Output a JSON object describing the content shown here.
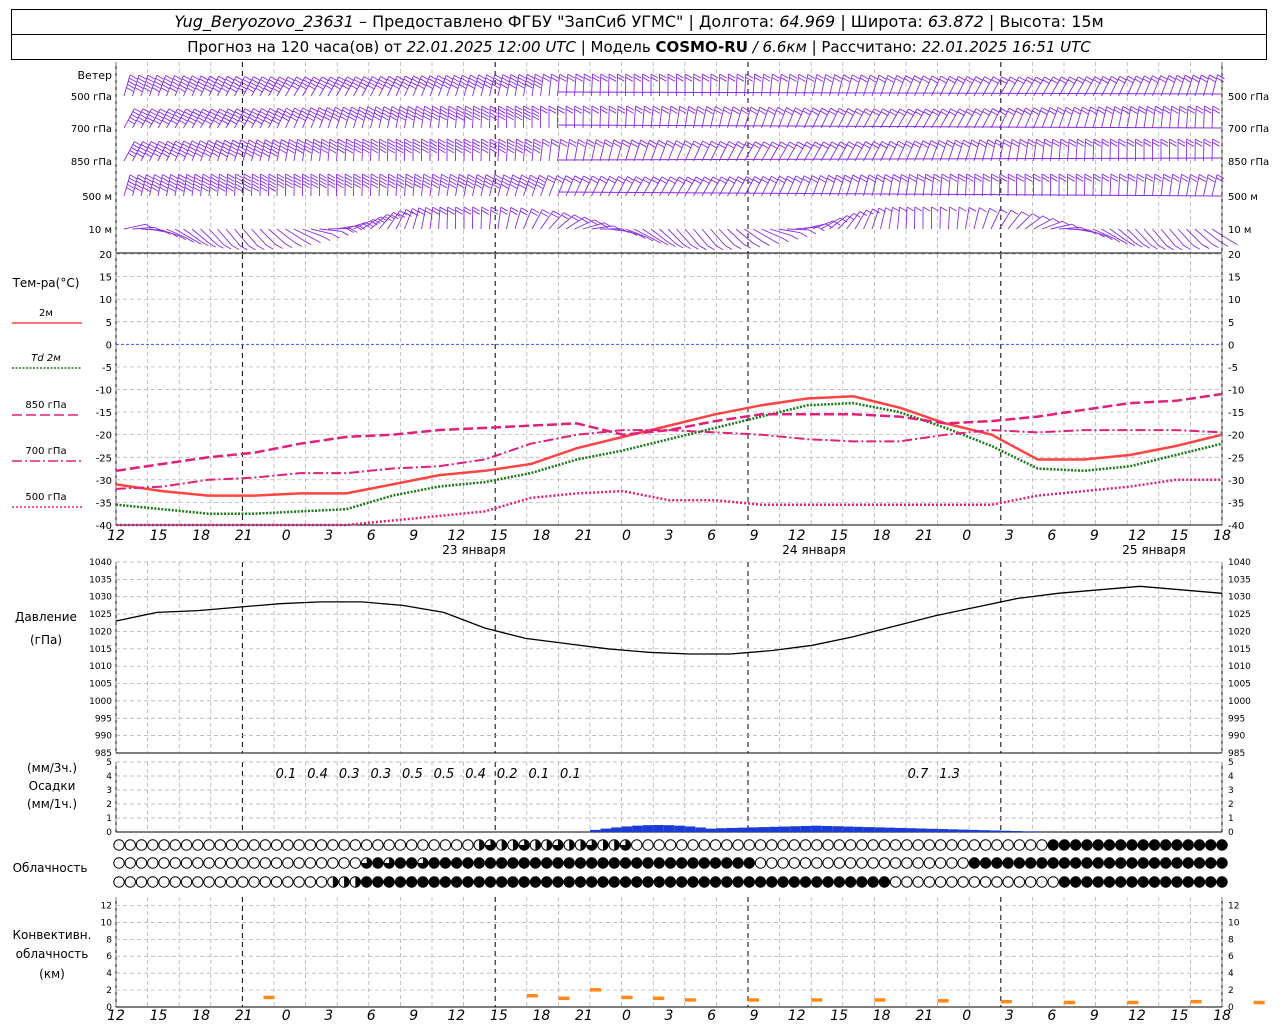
{
  "header": {
    "station": "Yug_Beryozovo_23631",
    "provider": "– Предоставлено ФГБУ \"ЗапСиб УГМС\"",
    "lon_label": "Долгота:",
    "lon_value": "64.969",
    "lat_label": "Широта:",
    "lat_value": "63.872",
    "alt_label": "Высота:",
    "alt_value": "15м",
    "forecast_prefix": "Прогноз на 120 часа(ов) от",
    "forecast_time": "22.01.2025 12:00 UTC",
    "model_label": "Модель",
    "model_name": "COSMO-RU",
    "model_res": "/ 6.6км",
    "calc_label": "Рассчитано:",
    "calc_time": "22.01.2025 16:51 UTC"
  },
  "hours": [
    "12",
    "15",
    "18",
    "21",
    "0",
    "3",
    "6",
    "9",
    "12",
    "15",
    "18",
    "21",
    "0",
    "3",
    "6",
    "9",
    "12",
    "15",
    "18",
    "21",
    "0",
    "3",
    "6",
    "9",
    "12",
    "15",
    "18"
  ],
  "days": [
    "23 января",
    "24 января",
    "25 января"
  ],
  "wind": {
    "title": "Ветер",
    "levels": [
      "500 гПа",
      "700 гПа",
      "850 гПа",
      "500 м",
      "10 м"
    ],
    "color": "#8a2be2"
  },
  "temperature": {
    "title": "Тем-ра(°C)",
    "legend": [
      {
        "label": "2м",
        "color": "#ff4444",
        "style": "solid"
      },
      {
        "label": "Td  2м",
        "color": "#1a7a1a",
        "style": "dotted"
      },
      {
        "label": "850 гПа",
        "color": "#e0207a",
        "style": "dash"
      },
      {
        "label": "700 гПа",
        "color": "#e0207a",
        "style": "dashdot"
      },
      {
        "label": "500 гПа",
        "color": "#e0207a",
        "style": "dot"
      }
    ],
    "ticks": [
      "20",
      "15",
      "10",
      "5",
      "0",
      "-5",
      "-10",
      "-15",
      "-20",
      "-25",
      "-30",
      "-35",
      "-40"
    ]
  },
  "pressure": {
    "title": "Давление",
    "unit": "(гПа)",
    "ticks": [
      "1040",
      "1035",
      "1030",
      "1025",
      "1020",
      "1015",
      "1010",
      "1005",
      "1000",
      "995",
      "990",
      "985"
    ]
  },
  "precip": {
    "title1": "(мм/3ч.)",
    "title2": "Осадки",
    "title3": "(мм/1ч.)",
    "ticks": [
      "5",
      "4",
      "3",
      "2",
      "1",
      "0"
    ],
    "labels": [
      {
        "h": 15,
        "text": "0.1"
      },
      {
        "h": 18,
        "text": "0.4"
      },
      {
        "h": 21,
        "text": "0.3"
      },
      {
        "h": 24,
        "text": "0.3"
      },
      {
        "h": 27,
        "text": "0.5"
      },
      {
        "h": 30,
        "text": "0.5"
      },
      {
        "h": 33,
        "text": "0.4"
      },
      {
        "h": 36,
        "text": "0.2"
      },
      {
        "h": 39,
        "text": "0.1"
      },
      {
        "h": 42,
        "text": "0.1"
      },
      {
        "h": 75,
        "text": "0.7"
      },
      {
        "h": 78,
        "text": "1.3"
      }
    ]
  },
  "clouds": {
    "title": "Облачность"
  },
  "convective": {
    "title1": "Конвективн.",
    "title2": "облачность",
    "title3": "(км)",
    "ticks": [
      "12",
      "10",
      "8",
      "6",
      "4",
      "2",
      "0"
    ]
  },
  "chart_data": {
    "type": "line",
    "x_hours_from_start": [
      0,
      3,
      6,
      9,
      12,
      15,
      18,
      21,
      24,
      27,
      30,
      33,
      36,
      39,
      42,
      45,
      48,
      51,
      54,
      57,
      60,
      63,
      66,
      69,
      72,
      75,
      78
    ],
    "start_time": "22.01.2025 12:00 UTC",
    "temperature_axis": {
      "ylim": [
        -40,
        20
      ],
      "ylabel": "Тем-ра(°C)"
    },
    "pressure_axis": {
      "ylim": [
        985,
        1040
      ],
      "ylabel": "Давление (гПа)"
    },
    "precip_axis": {
      "ylim": [
        0,
        5
      ]
    },
    "convective_axis": {
      "ylim": [
        0,
        13
      ],
      "ylabel": "Конвективн. облачность (км)"
    },
    "series": [
      {
        "name": "2м",
        "values": [
          -31,
          -32.5,
          -33.5,
          -33.5,
          -33,
          -33,
          -31,
          -29,
          -28,
          -26.5,
          -23,
          -20.5,
          -18,
          -15.5,
          -13.5,
          -12,
          -11.5,
          -14,
          -17.5,
          -20,
          -25.5,
          -25.5,
          -24.5,
          -22.5,
          -20
        ]
      },
      {
        "name": "Td  2м",
        "values": [
          -35.5,
          -36.5,
          -37.5,
          -37.5,
          -37,
          -36.5,
          -33.5,
          -31.5,
          -30.5,
          -28.5,
          -25.5,
          -23.5,
          -21,
          -18.5,
          -16,
          -13.5,
          -13,
          -15,
          -18.5,
          -22.5,
          -27.5,
          -28,
          -27,
          -24.5,
          -22
        ]
      },
      {
        "name": "850 гПа",
        "values": [
          -28,
          -26.5,
          -25,
          -24,
          -22,
          -20.5,
          -20,
          -19,
          -18.5,
          -18,
          -17.5,
          -20,
          -19,
          -17,
          -15.5,
          -15.5,
          -15.5,
          -16,
          -17.5,
          -17,
          -16,
          -14.5,
          -13,
          -12.5,
          -11
        ]
      },
      {
        "name": "700 гПа",
        "values": [
          -32,
          -31.5,
          -30,
          -29.5,
          -28.5,
          -28.5,
          -27.5,
          -27,
          -25.5,
          -22,
          -20,
          -19,
          -19,
          -19.5,
          -20,
          -21,
          -21.5,
          -21.5,
          -20,
          -19,
          -19.5,
          -19,
          -19,
          -19,
          -19.5
        ]
      },
      {
        "name": "500 гПа",
        "values": [
          -42,
          -42,
          -42,
          -42,
          -41,
          -40,
          -39,
          -38,
          -37,
          -34,
          -33,
          -32.5,
          -34.5,
          -34.5,
          -35.5,
          -35.5,
          -35.5,
          -35.5,
          -35.5,
          -35.5,
          -33.5,
          -32.5,
          -31.5,
          -30,
          -30
        ]
      },
      {
        "name": "Давление",
        "values": [
          1023,
          1025.5,
          1026,
          1027,
          1028,
          1028.5,
          1028.5,
          1027.5,
          1025.5,
          1021,
          1018,
          1016.5,
          1015,
          1014,
          1013.5,
          1013.5,
          1014.5,
          1016,
          1018.5,
          1021.5,
          1024.5,
          1027,
          1029.5,
          1031,
          1032,
          1033,
          1032,
          1031
        ]
      },
      {
        "name": "Осадки",
        "values": [
          0,
          0,
          0,
          0,
          0,
          0.1,
          0.4,
          0.3,
          0.3,
          0.5,
          0.5,
          0.4,
          0.2,
          0.1,
          0.1,
          0,
          0,
          0,
          0,
          0,
          0,
          0,
          0,
          0,
          0,
          0.7,
          1.3
        ]
      }
    ]
  }
}
